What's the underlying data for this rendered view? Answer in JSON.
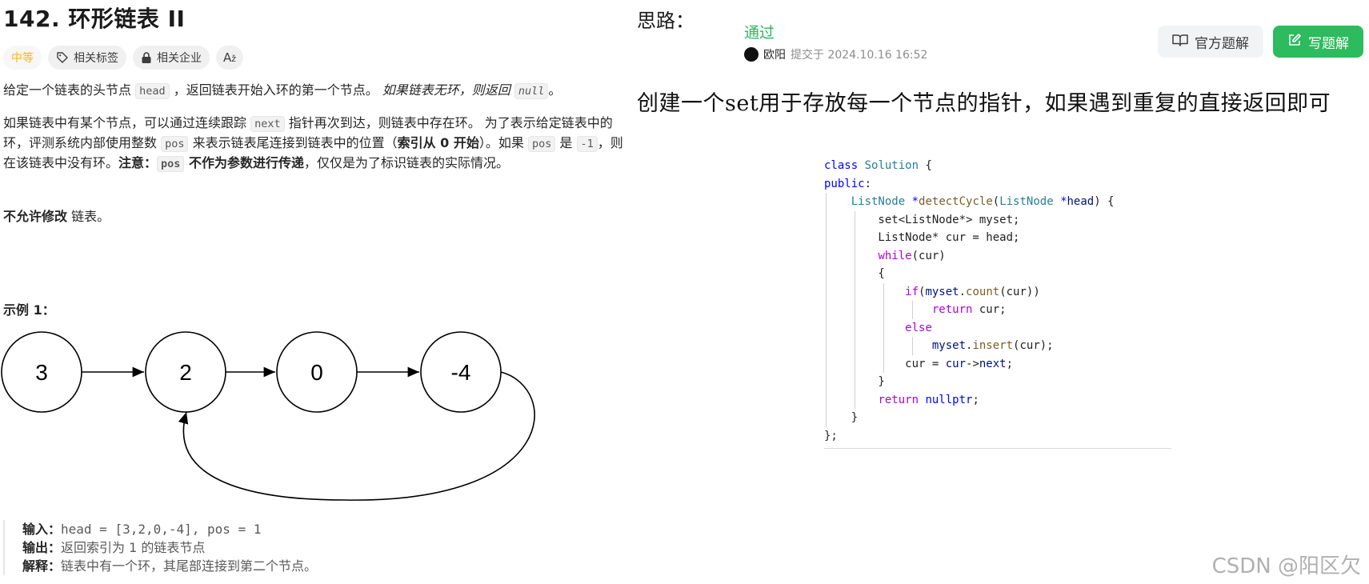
{
  "problem": {
    "title": "142. 环形链表 II",
    "tags": {
      "difficulty": "中等",
      "topics": "相关标签",
      "companies": "相关企业",
      "translate": "A"
    },
    "para1": {
      "t1": "给定一个链表的头节点 ",
      "c1": "head",
      "t2": " ，返回链表开始入环的第一个节点。",
      "it1": " 如果链表无环，则返回 ",
      "c2": "null",
      "t3": "。"
    },
    "para2": {
      "t1": "如果链表中有某个节点，可以通过连续跟踪 ",
      "c1": "next",
      "t2": " 指针再次到达，则链表中存在环。 为了表示给定链表中的环，评测系统内部使用整数 ",
      "c2": "pos",
      "t3": " 来表示链表尾连接到链表中的位置（",
      "b1": "索引从 0 开始",
      "t4": "）。如果 ",
      "c3": "pos",
      "t5": " 是 ",
      "c4": "-1",
      "t6": "，则在该链表中没有环。",
      "b2": "注意：",
      "c5": "pos",
      "b3": " 不作为参数进行传递",
      "t7": "，仅仅是为了标识链表的实际情况。"
    },
    "para3": {
      "b1": "不允许修改",
      "t1": " 链表。"
    },
    "example": {
      "title": "示例 1：",
      "nodes": [
        "3",
        "2",
        "0",
        "-4"
      ],
      "input_label": "输入：",
      "input_value": "head = [3,2,0,-4], pos = 1",
      "output_label": "输出：",
      "output_value": "返回索引为 1 的链表节点",
      "explain_label": "解释：",
      "explain_value": "链表中有一个环，其尾部连接到第二个节点。"
    }
  },
  "solution": {
    "thought_label": "思路：",
    "status": "通过",
    "submitter_name": "欧阳",
    "submitted_text": "提交于 2024.10.16 16:52",
    "official_button": "官方题解",
    "write_button": "写题解",
    "headline": "创建一个set用于存放每一个节点的指针，如果遇到重复的直接返回即可"
  },
  "watermark": "CSDN @阳区欠",
  "colors": {
    "accepted": "#2db55d",
    "medium": "#ffb800",
    "write_button_bg": "#2cbb5d"
  }
}
